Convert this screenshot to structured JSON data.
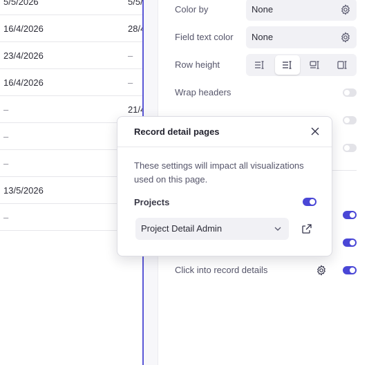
{
  "table": {
    "rows": [
      {
        "col1": "5/5/2026",
        "col2": "5/5/"
      },
      {
        "col1": "16/4/2026",
        "col2": "28/4"
      },
      {
        "col1": "23/4/2026",
        "col2": "–"
      },
      {
        "col1": "16/4/2026",
        "col2": "–"
      },
      {
        "col1": "–",
        "col2": "21/4"
      },
      {
        "col1": "–",
        "col2": ""
      },
      {
        "col1": "–",
        "col2": ""
      },
      {
        "col1": "13/5/2026",
        "col2": ""
      },
      {
        "col1": "–",
        "col2": ""
      }
    ]
  },
  "settings": {
    "color_by": {
      "label": "Color by",
      "value": "None"
    },
    "field_text_color": {
      "label": "Field text color",
      "value": "None"
    },
    "row_height": {
      "label": "Row height",
      "selected_index": 1
    },
    "wrap_headers": {
      "label": "Wrap headers",
      "enabled": false
    },
    "hidden_toggle_1": {
      "enabled": false
    },
    "hidden_toggle_2": {
      "enabled": false
    },
    "hidden_toggle_3": {
      "enabled": true
    },
    "hidden_toggle_4": {
      "enabled": true
    },
    "click_into_record": {
      "label": "Click into record details",
      "enabled": true
    }
  },
  "popover": {
    "title": "Record detail pages",
    "description": "These settings will impact all visualizations used on this page.",
    "section_label": "Projects",
    "section_enabled": true,
    "page_select_value": "Project Detail Admin"
  },
  "colors": {
    "accent": "#4a47d6",
    "toggle_off": "#e3e3e8"
  },
  "icons": [
    "gear-icon",
    "close-icon",
    "chevron-down-icon",
    "external-link-icon"
  ]
}
